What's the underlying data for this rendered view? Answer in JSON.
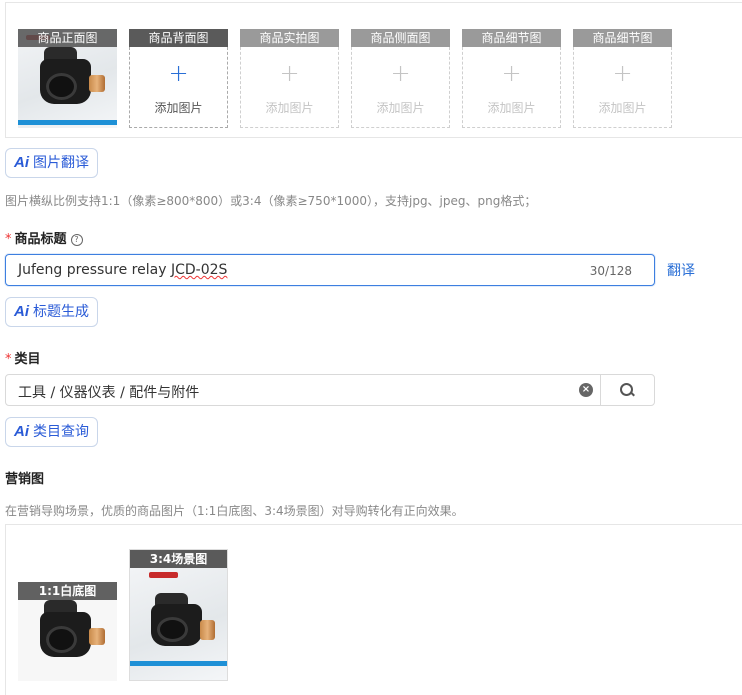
{
  "images": {
    "slots": [
      {
        "header": "商品正面图",
        "filled": true
      },
      {
        "header": "商品背面图",
        "add_text": "添加图片",
        "filled": false,
        "active": true
      },
      {
        "header": "商品实拍图",
        "add_text": "添加图片",
        "filled": false,
        "active": false
      },
      {
        "header": "商品侧面图",
        "add_text": "添加图片",
        "filled": false,
        "active": false
      },
      {
        "header": "商品细节图",
        "add_text": "添加图片",
        "filled": false,
        "active": false
      },
      {
        "header": "商品细节图",
        "add_text": "添加图片",
        "filled": false,
        "active": false
      }
    ],
    "ai_translate_label": "图片翻译",
    "hint": "图片横纵比例支持1:1（像素≥800*800）或3:4（像素≥750*1000），支持jpg、jpeg、png格式；"
  },
  "title_field": {
    "required_mark": "*",
    "label": "商品标题",
    "help_icon": "question-circle-icon",
    "value_prefix": "Jufeng pressure relay ",
    "value_flagged": "JCD-02S",
    "count": "30/128",
    "translate_link": "翻译",
    "ai_generate_label": "标题生成"
  },
  "category_field": {
    "required_mark": "*",
    "label": "类目",
    "value": "工具 / 仪器仪表 / 配件与附件",
    "clear_icon": "clear-circle-icon",
    "search_icon": "search-icon",
    "ai_query_label": "类目查询"
  },
  "marketing": {
    "label": "营销图",
    "hint": "在营销导购场景，优质的商品图片（1:1白底图、3:4场景图）对导购转化有正向效果。",
    "images": [
      {
        "header": "1:1白底图"
      },
      {
        "header": "3:4场景图"
      }
    ]
  },
  "ai_icon_text": "Ai",
  "plus_symbol": "+",
  "clear_symbol": "×",
  "colors": {
    "accent": "#2a5bd7",
    "header_active": "#5a5a5a",
    "header_inactive": "#9a9a9a",
    "plus_active": "#2a6fd6",
    "plus_inactive": "#c4c4c4",
    "required": "#ee3333",
    "input_focus_border": "#3d7fe0"
  }
}
